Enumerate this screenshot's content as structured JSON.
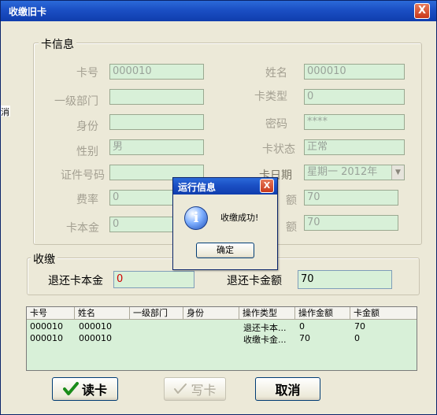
{
  "window": {
    "title": "收缴旧卡",
    "close_glyph": "X"
  },
  "left_strip_text": "消费",
  "card_info": {
    "legend": "卡信息",
    "fields": {
      "card_no": {
        "label": "卡号",
        "value": "000010"
      },
      "name": {
        "label": "姓名",
        "value": "000010"
      },
      "dept": {
        "label": "一级部门",
        "value": ""
      },
      "card_type": {
        "label": "卡类型",
        "value": "0"
      },
      "identity": {
        "label": "身份",
        "value": ""
      },
      "password": {
        "label": "密码",
        "value": "****"
      },
      "gender": {
        "label": "性别",
        "value": "男"
      },
      "card_status": {
        "label": "卡状态",
        "value": "正常"
      },
      "id_no": {
        "label": "证件号码",
        "value": ""
      },
      "date": {
        "label_visible": "卡日期",
        "value": "星期一 2012年"
      },
      "fee_rate": {
        "label": "费率",
        "value": "0"
      },
      "balance": {
        "label_visible": "额",
        "value": "70"
      },
      "principal": {
        "label": "卡本金",
        "value": "0"
      },
      "amount": {
        "label_visible": "额",
        "value": "70"
      }
    }
  },
  "collect": {
    "legend": "收缴",
    "refund_principal": {
      "label": "退还卡本金",
      "value": "0"
    },
    "refund_balance": {
      "label": "退还卡金额",
      "value": "70"
    }
  },
  "grid": {
    "headers": [
      "卡号",
      "姓名",
      "一级部门",
      "身份",
      "操作类型",
      "操作金额",
      "卡金额"
    ],
    "rows": [
      [
        "000010",
        "000010",
        "",
        "",
        "退还卡本...",
        "0",
        "70"
      ],
      [
        "000010",
        "000010",
        "",
        "",
        "收缴卡金...",
        "70",
        "0"
      ]
    ]
  },
  "buttons": {
    "read_card": "读卡",
    "write_card": "写卡",
    "cancel": "取消"
  },
  "dialog": {
    "title": "运行信息",
    "close_glyph": "X",
    "icon_glyph": "i",
    "message": "收缴成功!",
    "ok_label": "确定"
  },
  "colors": {
    "titlebar": "#1b4fc4",
    "field_bg": "#d8f0d8",
    "window_bg": "#ece9d8",
    "check_green": "#1a8c1a"
  }
}
